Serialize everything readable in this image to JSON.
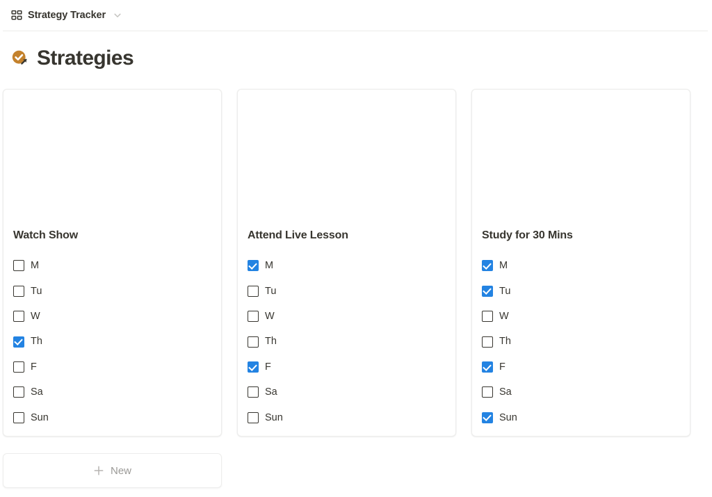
{
  "topbar": {
    "icon": "grid-gallery-icon",
    "title": "Strategy Tracker",
    "chevron": "chevron-down-icon"
  },
  "page": {
    "icon": "orange-check-circle-icon",
    "icon_color": "#c4822d",
    "title": "Strategies"
  },
  "theme": {
    "checked_color": "#2383e2",
    "unchecked_border": "#37352f",
    "card_border": "#ededec",
    "text_color": "#37352f",
    "muted_text": "#9b9a97"
  },
  "gallery": {
    "cards": [
      {
        "title": "Watch Show",
        "days": [
          {
            "label": "M",
            "checked": false
          },
          {
            "label": "Tu",
            "checked": false
          },
          {
            "label": "W",
            "checked": false
          },
          {
            "label": "Th",
            "checked": true
          },
          {
            "label": "F",
            "checked": false
          },
          {
            "label": "Sa",
            "checked": false
          },
          {
            "label": "Sun",
            "checked": false
          }
        ]
      },
      {
        "title": "Attend Live Lesson",
        "days": [
          {
            "label": "M",
            "checked": true
          },
          {
            "label": "Tu",
            "checked": false
          },
          {
            "label": "W",
            "checked": false
          },
          {
            "label": "Th",
            "checked": false
          },
          {
            "label": "F",
            "checked": true
          },
          {
            "label": "Sa",
            "checked": false
          },
          {
            "label": "Sun",
            "checked": false
          }
        ]
      },
      {
        "title": "Study for 30 Mins",
        "days": [
          {
            "label": "M",
            "checked": true
          },
          {
            "label": "Tu",
            "checked": true
          },
          {
            "label": "W",
            "checked": false
          },
          {
            "label": "Th",
            "checked": false
          },
          {
            "label": "F",
            "checked": true
          },
          {
            "label": "Sa",
            "checked": false
          },
          {
            "label": "Sun",
            "checked": true
          }
        ]
      }
    ]
  },
  "new_button": {
    "icon": "plus-icon",
    "label": "New"
  }
}
